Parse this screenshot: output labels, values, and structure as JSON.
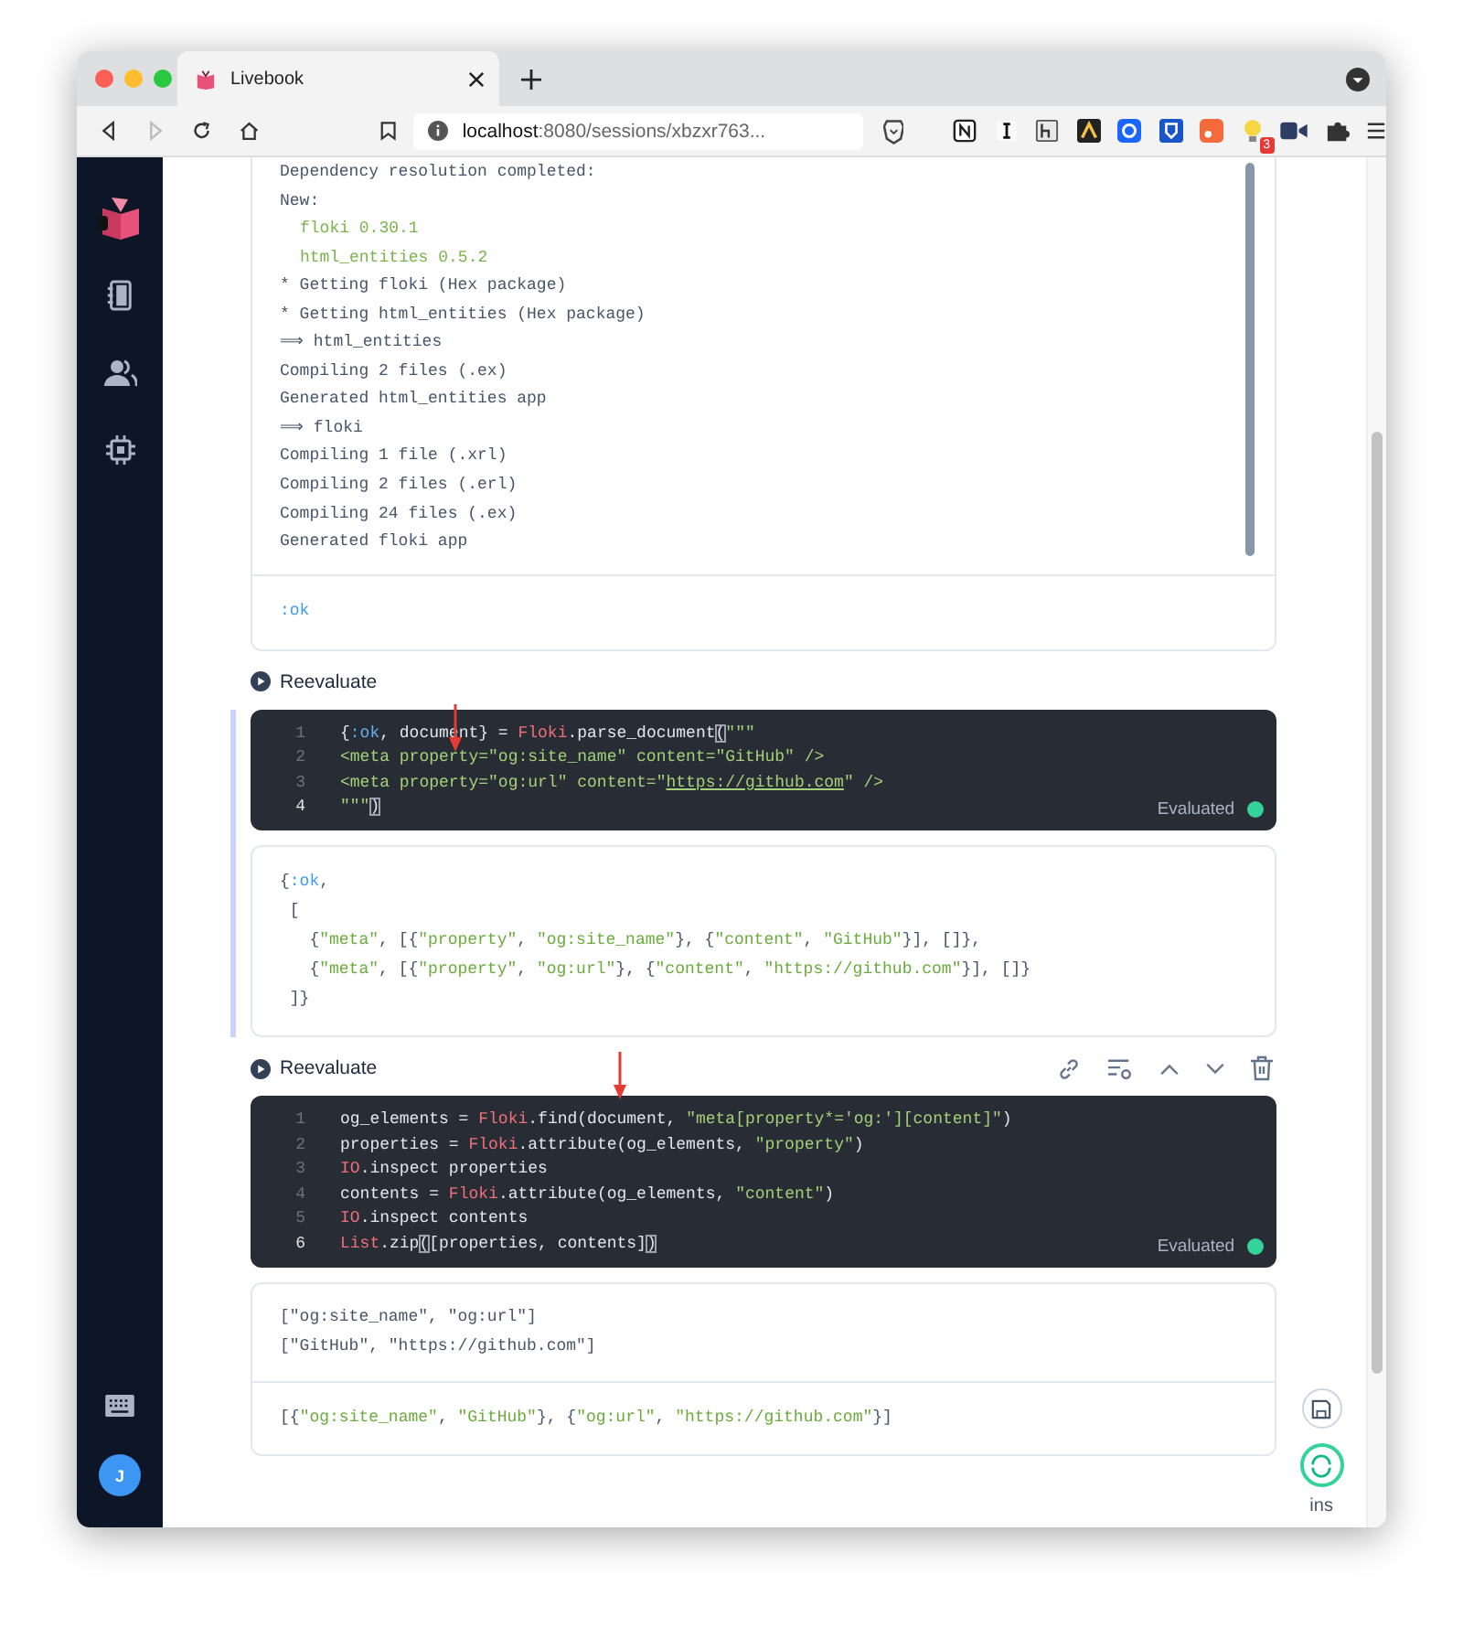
{
  "browser": {
    "tab_title": "Livebook",
    "address_host": "localhost",
    "address_path": ":8080/sessions/xbzxr763...",
    "extension_badge": "3"
  },
  "sidebar": {
    "avatar": "J"
  },
  "log_output": {
    "lines": [
      {
        "text": "Dependency resolution completed:",
        "kind": "plain"
      },
      {
        "text": "New:",
        "kind": "plain"
      },
      {
        "text": "floki 0.30.1",
        "kind": "package"
      },
      {
        "text": "html_entities 0.5.2",
        "kind": "package"
      },
      {
        "text": "* Getting floki (Hex package)",
        "kind": "plain"
      },
      {
        "text": "* Getting html_entities (Hex package)",
        "kind": "plain"
      },
      {
        "text": "⟹ html_entities",
        "kind": "plain"
      },
      {
        "text": "Compiling 2 files (.ex)",
        "kind": "plain"
      },
      {
        "text": "Generated html_entities app",
        "kind": "plain"
      },
      {
        "text": "⟹ floki",
        "kind": "plain"
      },
      {
        "text": "Compiling 1 file (.xrl)",
        "kind": "plain"
      },
      {
        "text": "Compiling 2 files (.erl)",
        "kind": "plain"
      },
      {
        "text": "Compiling 24 files (.ex)",
        "kind": "plain"
      },
      {
        "text": "Generated floki app",
        "kind": "plain"
      }
    ],
    "result": [
      {
        "text": ":ok",
        "kind": "atom"
      }
    ]
  },
  "cells": [
    {
      "action": "Reevaluate",
      "focused": true,
      "show_actions": false,
      "status": "Evaluated",
      "code": [
        {
          "number": "1",
          "current": false,
          "tokens": [
            {
              "text": "{",
              "kind": "plain"
            },
            {
              "text": ":ok",
              "kind": "atom"
            },
            {
              "text": ", document} = ",
              "kind": "plain"
            },
            {
              "text": "Floki",
              "kind": "module"
            },
            {
              "text": ".parse_document",
              "kind": "plain"
            },
            {
              "text": "(",
              "kind": "bracket"
            },
            {
              "text": "\"\"\"",
              "kind": "string"
            }
          ]
        },
        {
          "number": "2",
          "current": false,
          "tokens": [
            {
              "text": "<meta property=\"og:site_name\" content=\"GitHub\" />",
              "kind": "string"
            }
          ]
        },
        {
          "number": "3",
          "current": false,
          "tokens": [
            {
              "text": "<meta property=\"og:url\" content=\"",
              "kind": "string"
            },
            {
              "text": "https://github.com",
              "kind": "link"
            },
            {
              "text": "\" />",
              "kind": "string"
            }
          ]
        },
        {
          "number": "4",
          "current": true,
          "tokens": [
            {
              "text": "\"\"\"",
              "kind": "string"
            },
            {
              "text": ")",
              "kind": "bracket"
            }
          ]
        }
      ],
      "outputs": [
        {
          "kind": "result",
          "lines": [
            [
              {
                "text": "{",
                "kind": "plain"
              },
              {
                "text": ":ok",
                "kind": "atom"
              },
              {
                "text": ",",
                "kind": "plain"
              }
            ],
            [
              {
                "text": " [",
                "kind": "plain"
              }
            ],
            [
              {
                "text": "   {",
                "kind": "plain"
              },
              {
                "text": "\"meta\"",
                "kind": "string"
              },
              {
                "text": ", [{",
                "kind": "plain"
              },
              {
                "text": "\"property\"",
                "kind": "string"
              },
              {
                "text": ", ",
                "kind": "plain"
              },
              {
                "text": "\"og:site_name\"",
                "kind": "string"
              },
              {
                "text": "}, {",
                "kind": "plain"
              },
              {
                "text": "\"content\"",
                "kind": "string"
              },
              {
                "text": ", ",
                "kind": "plain"
              },
              {
                "text": "\"GitHub\"",
                "kind": "string"
              },
              {
                "text": "}], []},",
                "kind": "plain"
              }
            ],
            [
              {
                "text": "   {",
                "kind": "plain"
              },
              {
                "text": "\"meta\"",
                "kind": "string"
              },
              {
                "text": ", [{",
                "kind": "plain"
              },
              {
                "text": "\"property\"",
                "kind": "string"
              },
              {
                "text": ", ",
                "kind": "plain"
              },
              {
                "text": "\"og:url\"",
                "kind": "string"
              },
              {
                "text": "}, {",
                "kind": "plain"
              },
              {
                "text": "\"content\"",
                "kind": "string"
              },
              {
                "text": ", ",
                "kind": "plain"
              },
              {
                "text": "\"https://github.com\"",
                "kind": "string"
              },
              {
                "text": "}], []}",
                "kind": "plain"
              }
            ],
            [
              {
                "text": " ]}",
                "kind": "plain"
              }
            ]
          ]
        }
      ]
    },
    {
      "action": "Reevaluate",
      "focused": false,
      "show_actions": true,
      "status": "Evaluated",
      "code": [
        {
          "number": "1",
          "current": false,
          "tokens": [
            {
              "text": "og_elements = ",
              "kind": "plain"
            },
            {
              "text": "Floki",
              "kind": "module"
            },
            {
              "text": ".find(document, ",
              "kind": "plain"
            },
            {
              "text": "\"meta[property*='og:'][content]\"",
              "kind": "string"
            },
            {
              "text": ")",
              "kind": "plain"
            }
          ]
        },
        {
          "number": "2",
          "current": false,
          "tokens": [
            {
              "text": "properties = ",
              "kind": "plain"
            },
            {
              "text": "Floki",
              "kind": "module"
            },
            {
              "text": ".attribute(og_elements, ",
              "kind": "plain"
            },
            {
              "text": "\"property\"",
              "kind": "string"
            },
            {
              "text": ")",
              "kind": "plain"
            }
          ]
        },
        {
          "number": "3",
          "current": false,
          "tokens": [
            {
              "text": "IO",
              "kind": "module"
            },
            {
              "text": ".inspect properties",
              "kind": "plain"
            }
          ]
        },
        {
          "number": "4",
          "current": false,
          "tokens": [
            {
              "text": "contents = ",
              "kind": "plain"
            },
            {
              "text": "Floki",
              "kind": "module"
            },
            {
              "text": ".attribute(og_elements, ",
              "kind": "plain"
            },
            {
              "text": "\"content\"",
              "kind": "string"
            },
            {
              "text": ")",
              "kind": "plain"
            }
          ]
        },
        {
          "number": "5",
          "current": false,
          "tokens": [
            {
              "text": "IO",
              "kind": "module"
            },
            {
              "text": ".inspect contents",
              "kind": "plain"
            }
          ]
        },
        {
          "number": "6",
          "current": true,
          "tokens": [
            {
              "text": "List",
              "kind": "module"
            },
            {
              "text": ".zip",
              "kind": "plain"
            },
            {
              "text": "(",
              "kind": "bracket"
            },
            {
              "text": "[properties, contents]",
              "kind": "plain"
            },
            {
              "text": ")",
              "kind": "bracket"
            }
          ]
        }
      ],
      "outputs": [
        {
          "kind": "stdout",
          "lines": [
            [
              {
                "text": "[\"og:site_name\", \"og:url\"]",
                "kind": "plain"
              }
            ],
            [
              {
                "text": "[\"GitHub\", \"https://github.com\"]",
                "kind": "plain"
              }
            ]
          ]
        },
        {
          "kind": "result",
          "lines": [
            [
              {
                "text": "[{",
                "kind": "plain"
              },
              {
                "text": "\"og:site_name\"",
                "kind": "string"
              },
              {
                "text": ", ",
                "kind": "plain"
              },
              {
                "text": "\"GitHub\"",
                "kind": "string"
              },
              {
                "text": "}, {",
                "kind": "plain"
              },
              {
                "text": "\"og:url\"",
                "kind": "string"
              },
              {
                "text": ", ",
                "kind": "plain"
              },
              {
                "text": "\"https://github.com\"",
                "kind": "string"
              },
              {
                "text": "}]",
                "kind": "plain"
              }
            ]
          ]
        }
      ]
    }
  ],
  "rail": {
    "mode": "ins"
  }
}
